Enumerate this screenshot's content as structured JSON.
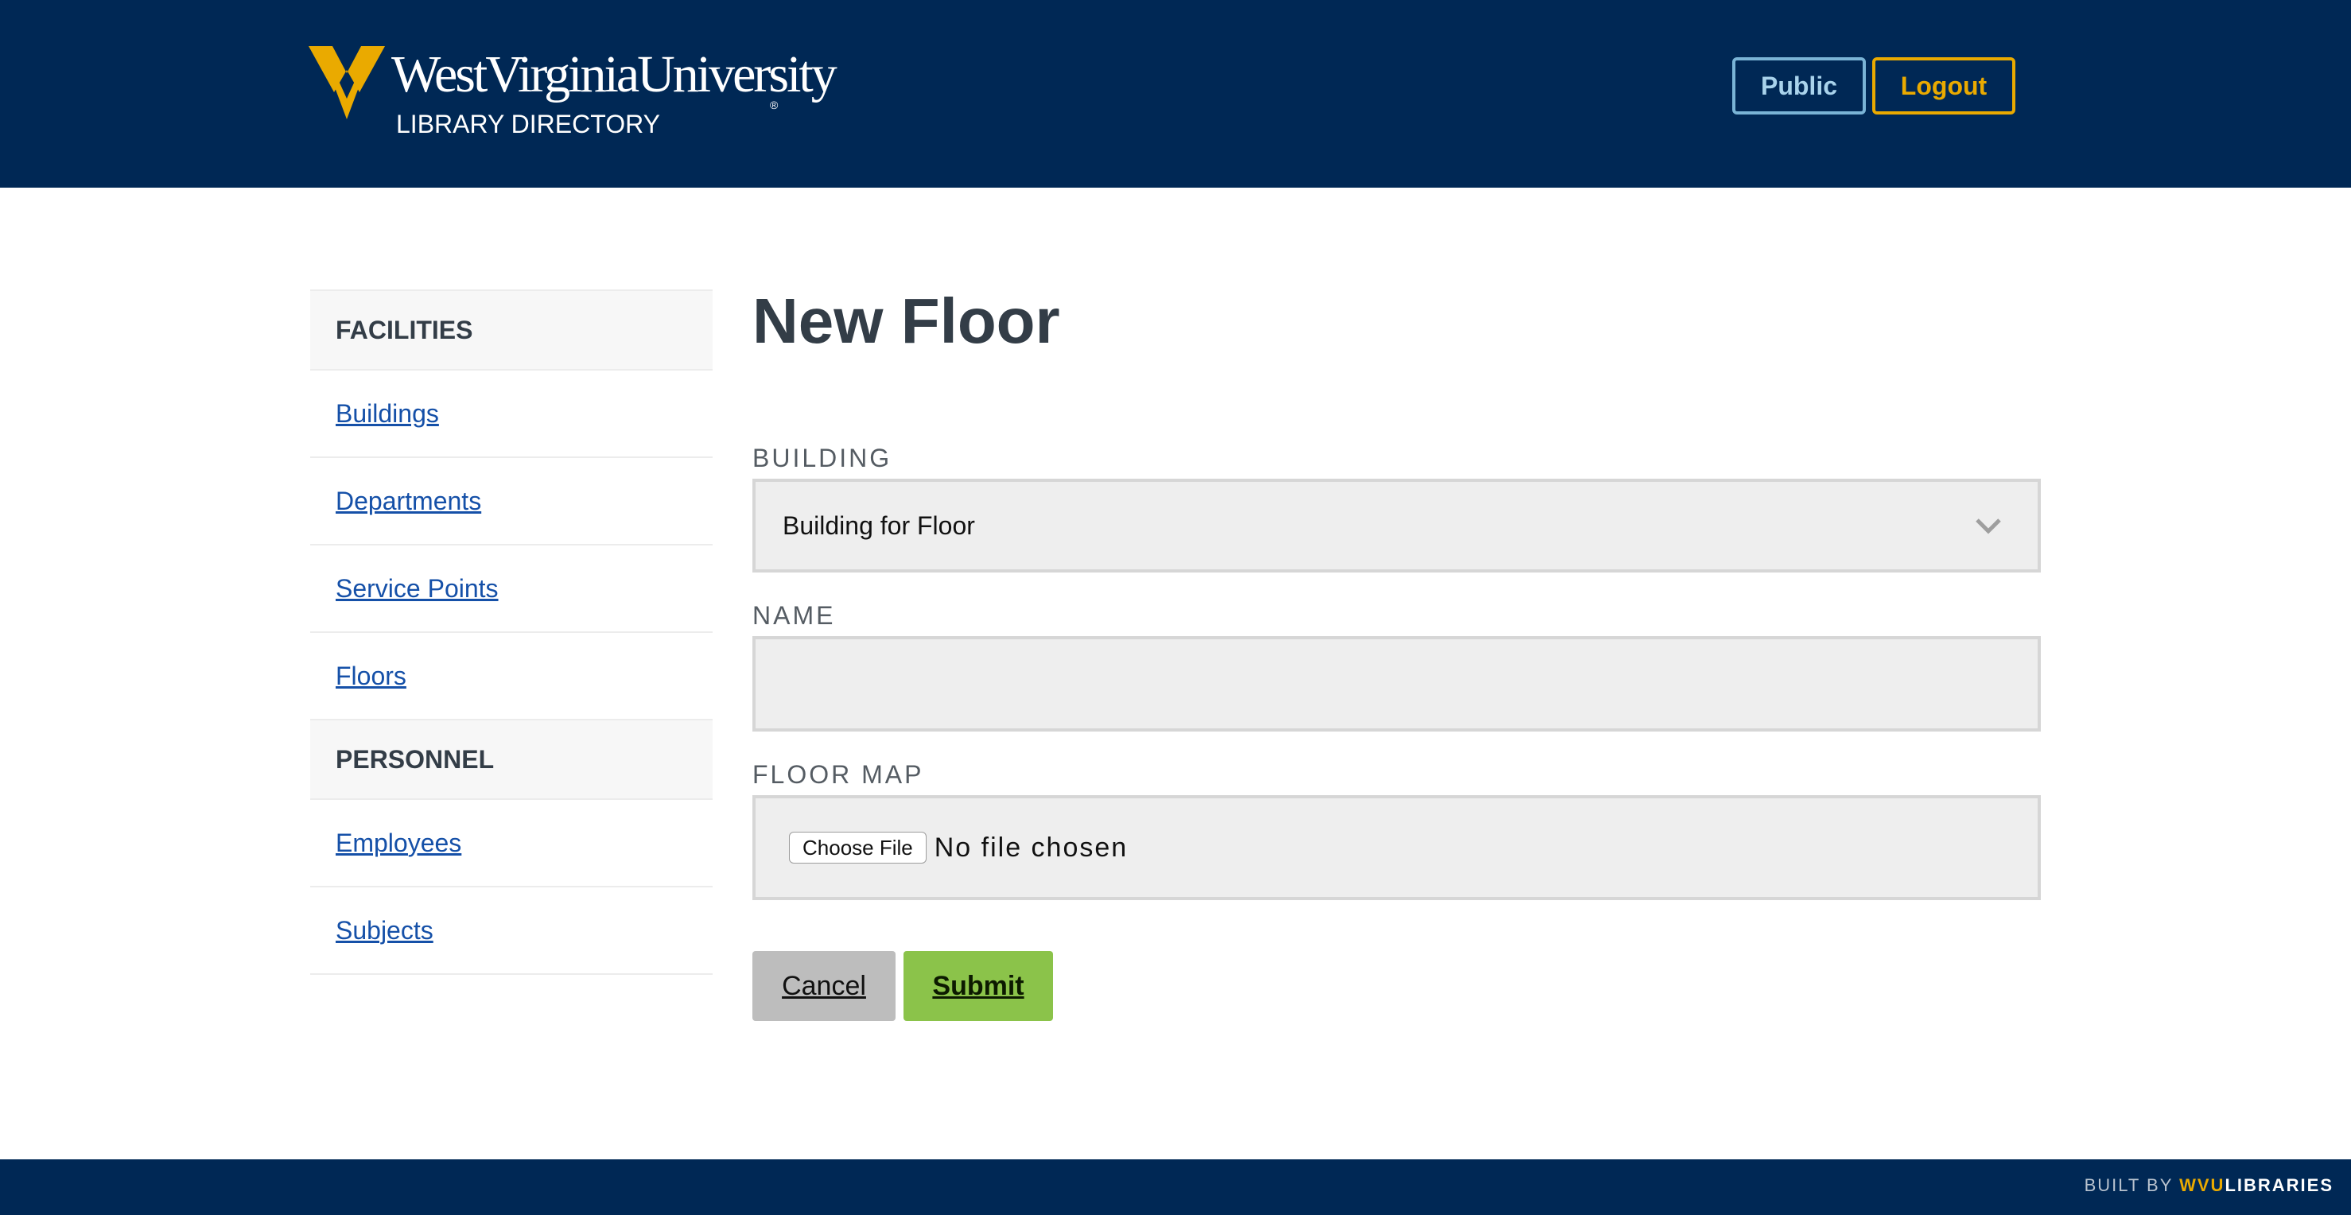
{
  "header": {
    "logo_wordmark": "WestVirginiaUniversity",
    "logo_registered": "®",
    "logo_subtitle": "LIBRARY DIRECTORY",
    "public_label": "Public",
    "logout_label": "Logout"
  },
  "sidebar": {
    "sections": [
      {
        "heading": "FACILITIES",
        "items": [
          {
            "label": "Buildings"
          },
          {
            "label": "Departments"
          },
          {
            "label": "Service Points"
          },
          {
            "label": "Floors"
          }
        ]
      },
      {
        "heading": "PERSONNEL",
        "items": [
          {
            "label": "Employees"
          },
          {
            "label": "Subjects"
          }
        ]
      }
    ]
  },
  "main": {
    "title": "New Floor",
    "building": {
      "label": "BUILDING",
      "selected": "Building for Floor"
    },
    "name": {
      "label": "NAME",
      "value": ""
    },
    "floor_map": {
      "label": "FLOOR MAP",
      "button_label": "Choose File",
      "status": "No file chosen"
    },
    "cancel_label": "Cancel",
    "submit_label": "Submit"
  },
  "footer": {
    "built_by": "BUILT BY ",
    "brand_wvu": "WVU",
    "brand_libraries": "LIBRARIES"
  },
  "colors": {
    "navy": "#002855",
    "gold": "#eaaa00",
    "link": "#1550a8",
    "submit_green": "#8bc34a",
    "cancel_gray": "#bdbdbd"
  }
}
